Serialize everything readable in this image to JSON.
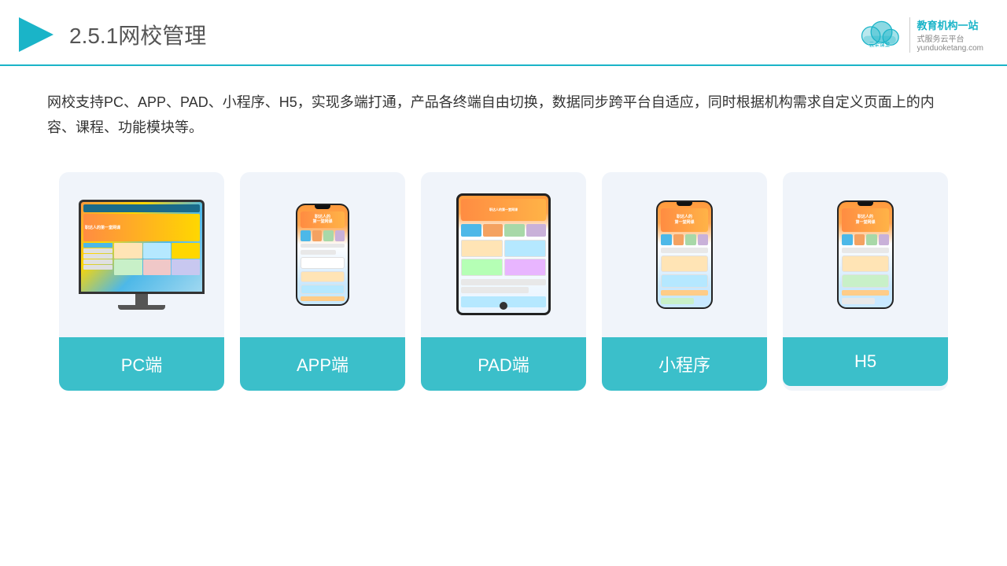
{
  "header": {
    "title_prefix": "2.5.1",
    "title_main": "网校管理",
    "logo_name": "云朵课堂",
    "logo_url": "yunduoketang.com",
    "logo_tagline": "教育机构一站",
    "logo_tagline2": "式服务云平台"
  },
  "description": "网校支持PC、APP、PAD、小程序、H5，实现多端打通，产品各终端自由切换，数据同步跨平台自适应，同时根据机构需求自定义页面上的内容、课程、功能模块等。",
  "cards": [
    {
      "id": "pc",
      "label": "PC端"
    },
    {
      "id": "app",
      "label": "APP端"
    },
    {
      "id": "pad",
      "label": "PAD端"
    },
    {
      "id": "miniprogram",
      "label": "小程序"
    },
    {
      "id": "h5",
      "label": "H5"
    }
  ],
  "brand_color": "#3bbfca",
  "accent_color": "#ff9a3c"
}
